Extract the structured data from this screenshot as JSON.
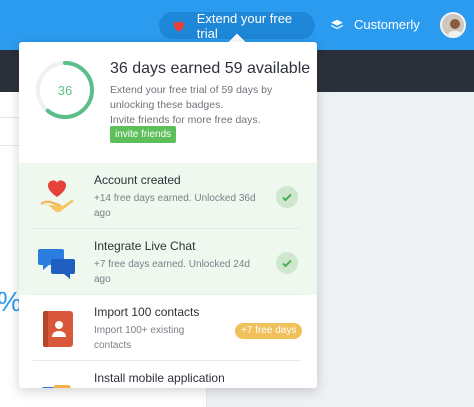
{
  "topbar": {
    "trial_label": "Extend your free trial",
    "brand_label": "Customerly"
  },
  "popup": {
    "progress_value": "36",
    "progress_fraction": 0.61,
    "title": "36 days earned 59 available",
    "description": "Extend your free trial of 59 days by unlocking these badges.",
    "description2": "Invite friends for more free days.",
    "invite_button": "invite friends",
    "items": [
      {
        "title": "Account created",
        "sub": "+14 free days earned. Unlocked 36d ago",
        "status": "completed",
        "icon": "heart-hand-icon"
      },
      {
        "title": "Integrate Live Chat",
        "sub": "+7 free days earned. Unlocked 24d ago",
        "status": "completed",
        "icon": "chat-bubbles-icon"
      },
      {
        "title": "Import 100 contacts",
        "sub": "Import 100+ existing contacts",
        "status": "available",
        "reward": "+7 free days",
        "icon": "address-book-icon"
      },
      {
        "title": "Install mobile application",
        "sub": "",
        "status": "available",
        "icon": "mobile-app-icon"
      }
    ]
  },
  "background": {
    "percent_fragment": "%"
  },
  "colors": {
    "topbar": "#2b9bf0",
    "completed_bg": "#eef8ee",
    "success": "#5cbf5c",
    "reward": "#f0c05a"
  }
}
